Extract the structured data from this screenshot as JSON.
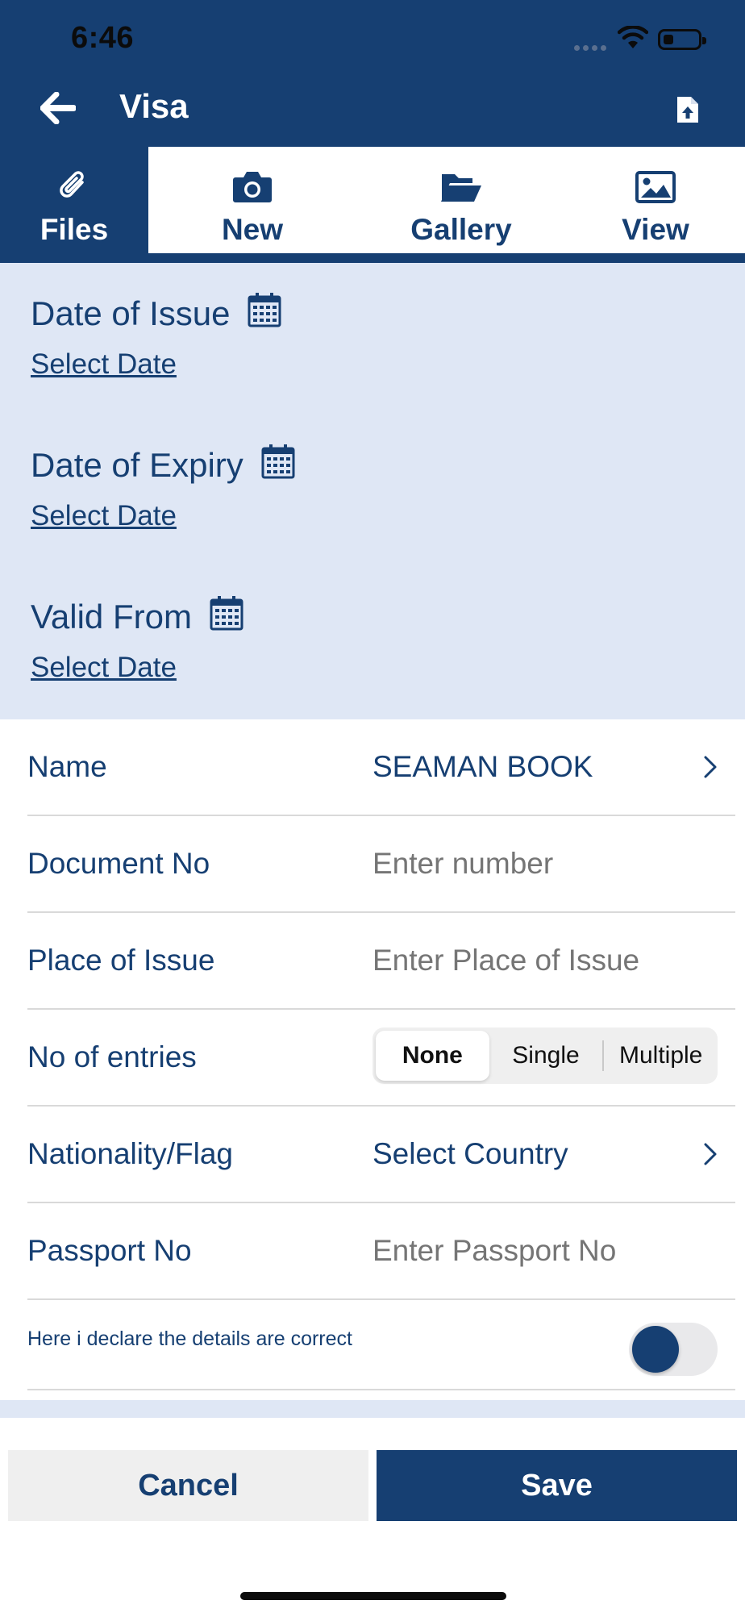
{
  "status_bar": {
    "time": "6:46"
  },
  "header": {
    "title": "Visa",
    "back_icon": "arrow-left-icon",
    "upload_icon": "file-upload-icon"
  },
  "tabs": [
    {
      "label": "Files",
      "icon": "paperclip-icon",
      "active": true
    },
    {
      "label": "New",
      "icon": "camera-icon",
      "active": false
    },
    {
      "label": "Gallery",
      "icon": "folder-open-icon",
      "active": false
    },
    {
      "label": "View",
      "icon": "image-icon",
      "active": false
    }
  ],
  "dates": [
    {
      "label": "Date of Issue",
      "link": "Select Date",
      "icon": "calendar-icon"
    },
    {
      "label": "Date of Expiry",
      "link": "Select Date",
      "icon": "calendar-icon"
    },
    {
      "label": "Valid From",
      "link": "Select Date",
      "icon": "calendar-icon"
    }
  ],
  "form": {
    "name": {
      "label": "Name",
      "value": "SEAMAN BOOK"
    },
    "document_no": {
      "label": "Document No",
      "placeholder": "Enter number"
    },
    "place_of_issue": {
      "label": "Place of Issue",
      "placeholder": "Enter Place of Issue"
    },
    "entries": {
      "label": "No of entries",
      "options": [
        "None",
        "Single",
        "Multiple"
      ],
      "selected": "None"
    },
    "nationality": {
      "label": "Nationality/Flag",
      "value": "Select Country"
    },
    "passport_no": {
      "label": "Passport No",
      "placeholder": "Enter Passport No"
    },
    "declaration": {
      "label": "Here i declare the details are correct"
    }
  },
  "actions": {
    "cancel_label": "Cancel",
    "save_label": "Save"
  },
  "colors": {
    "primary": "#163f72",
    "section_bg": "#dfe7f5",
    "placeholder": "#b4b4b4"
  }
}
